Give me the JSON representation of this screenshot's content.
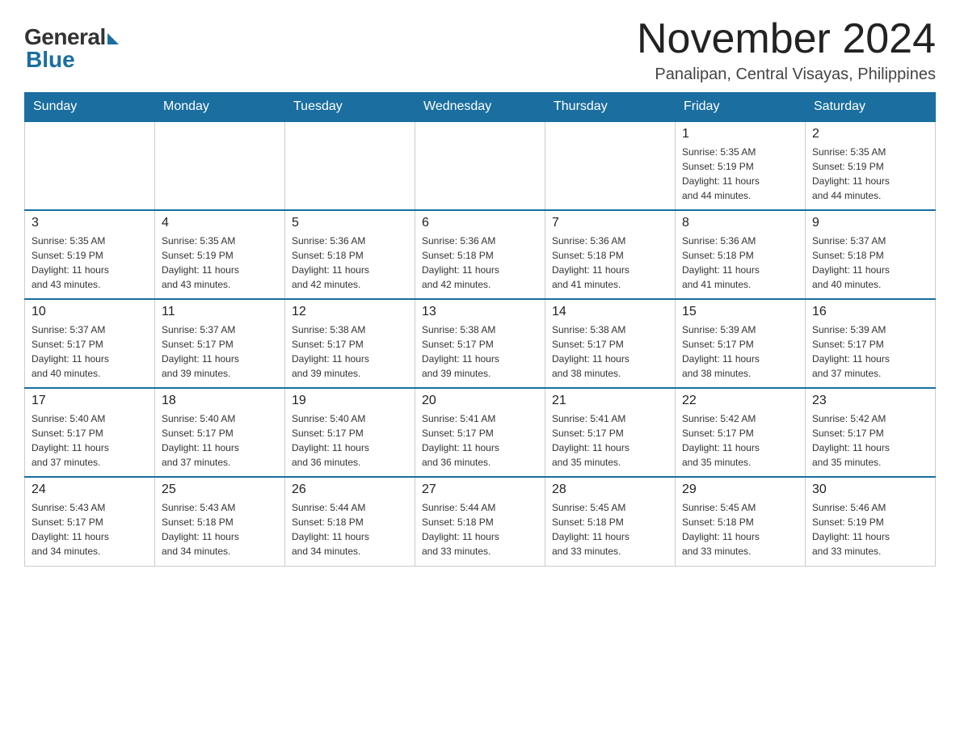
{
  "header": {
    "logo_general": "General",
    "logo_blue": "Blue",
    "month_title": "November 2024",
    "location": "Panalipan, Central Visayas, Philippines"
  },
  "days_of_week": [
    "Sunday",
    "Monday",
    "Tuesday",
    "Wednesday",
    "Thursday",
    "Friday",
    "Saturday"
  ],
  "weeks": [
    [
      {
        "day": "",
        "info": ""
      },
      {
        "day": "",
        "info": ""
      },
      {
        "day": "",
        "info": ""
      },
      {
        "day": "",
        "info": ""
      },
      {
        "day": "",
        "info": ""
      },
      {
        "day": "1",
        "info": "Sunrise: 5:35 AM\nSunset: 5:19 PM\nDaylight: 11 hours\nand 44 minutes."
      },
      {
        "day": "2",
        "info": "Sunrise: 5:35 AM\nSunset: 5:19 PM\nDaylight: 11 hours\nand 44 minutes."
      }
    ],
    [
      {
        "day": "3",
        "info": "Sunrise: 5:35 AM\nSunset: 5:19 PM\nDaylight: 11 hours\nand 43 minutes."
      },
      {
        "day": "4",
        "info": "Sunrise: 5:35 AM\nSunset: 5:19 PM\nDaylight: 11 hours\nand 43 minutes."
      },
      {
        "day": "5",
        "info": "Sunrise: 5:36 AM\nSunset: 5:18 PM\nDaylight: 11 hours\nand 42 minutes."
      },
      {
        "day": "6",
        "info": "Sunrise: 5:36 AM\nSunset: 5:18 PM\nDaylight: 11 hours\nand 42 minutes."
      },
      {
        "day": "7",
        "info": "Sunrise: 5:36 AM\nSunset: 5:18 PM\nDaylight: 11 hours\nand 41 minutes."
      },
      {
        "day": "8",
        "info": "Sunrise: 5:36 AM\nSunset: 5:18 PM\nDaylight: 11 hours\nand 41 minutes."
      },
      {
        "day": "9",
        "info": "Sunrise: 5:37 AM\nSunset: 5:18 PM\nDaylight: 11 hours\nand 40 minutes."
      }
    ],
    [
      {
        "day": "10",
        "info": "Sunrise: 5:37 AM\nSunset: 5:17 PM\nDaylight: 11 hours\nand 40 minutes."
      },
      {
        "day": "11",
        "info": "Sunrise: 5:37 AM\nSunset: 5:17 PM\nDaylight: 11 hours\nand 39 minutes."
      },
      {
        "day": "12",
        "info": "Sunrise: 5:38 AM\nSunset: 5:17 PM\nDaylight: 11 hours\nand 39 minutes."
      },
      {
        "day": "13",
        "info": "Sunrise: 5:38 AM\nSunset: 5:17 PM\nDaylight: 11 hours\nand 39 minutes."
      },
      {
        "day": "14",
        "info": "Sunrise: 5:38 AM\nSunset: 5:17 PM\nDaylight: 11 hours\nand 38 minutes."
      },
      {
        "day": "15",
        "info": "Sunrise: 5:39 AM\nSunset: 5:17 PM\nDaylight: 11 hours\nand 38 minutes."
      },
      {
        "day": "16",
        "info": "Sunrise: 5:39 AM\nSunset: 5:17 PM\nDaylight: 11 hours\nand 37 minutes."
      }
    ],
    [
      {
        "day": "17",
        "info": "Sunrise: 5:40 AM\nSunset: 5:17 PM\nDaylight: 11 hours\nand 37 minutes."
      },
      {
        "day": "18",
        "info": "Sunrise: 5:40 AM\nSunset: 5:17 PM\nDaylight: 11 hours\nand 37 minutes."
      },
      {
        "day": "19",
        "info": "Sunrise: 5:40 AM\nSunset: 5:17 PM\nDaylight: 11 hours\nand 36 minutes."
      },
      {
        "day": "20",
        "info": "Sunrise: 5:41 AM\nSunset: 5:17 PM\nDaylight: 11 hours\nand 36 minutes."
      },
      {
        "day": "21",
        "info": "Sunrise: 5:41 AM\nSunset: 5:17 PM\nDaylight: 11 hours\nand 35 minutes."
      },
      {
        "day": "22",
        "info": "Sunrise: 5:42 AM\nSunset: 5:17 PM\nDaylight: 11 hours\nand 35 minutes."
      },
      {
        "day": "23",
        "info": "Sunrise: 5:42 AM\nSunset: 5:17 PM\nDaylight: 11 hours\nand 35 minutes."
      }
    ],
    [
      {
        "day": "24",
        "info": "Sunrise: 5:43 AM\nSunset: 5:17 PM\nDaylight: 11 hours\nand 34 minutes."
      },
      {
        "day": "25",
        "info": "Sunrise: 5:43 AM\nSunset: 5:18 PM\nDaylight: 11 hours\nand 34 minutes."
      },
      {
        "day": "26",
        "info": "Sunrise: 5:44 AM\nSunset: 5:18 PM\nDaylight: 11 hours\nand 34 minutes."
      },
      {
        "day": "27",
        "info": "Sunrise: 5:44 AM\nSunset: 5:18 PM\nDaylight: 11 hours\nand 33 minutes."
      },
      {
        "day": "28",
        "info": "Sunrise: 5:45 AM\nSunset: 5:18 PM\nDaylight: 11 hours\nand 33 minutes."
      },
      {
        "day": "29",
        "info": "Sunrise: 5:45 AM\nSunset: 5:18 PM\nDaylight: 11 hours\nand 33 minutes."
      },
      {
        "day": "30",
        "info": "Sunrise: 5:46 AM\nSunset: 5:19 PM\nDaylight: 11 hours\nand 33 minutes."
      }
    ]
  ]
}
